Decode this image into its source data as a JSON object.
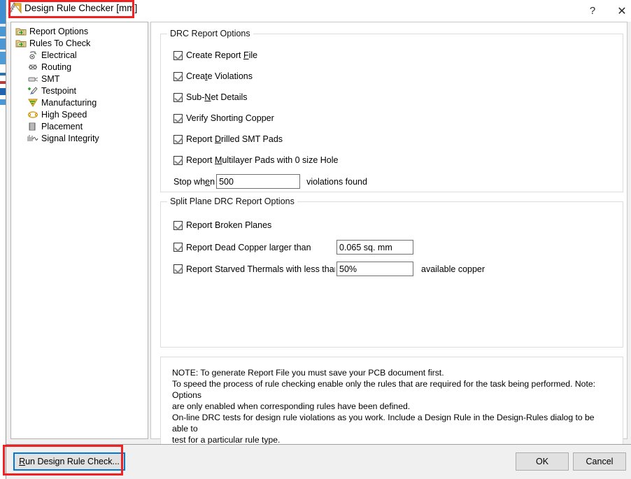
{
  "window": {
    "title": "Design Rule Checker [mm]",
    "icon": "design-rule-checker-icon",
    "help_label": "?",
    "close_label": "✕"
  },
  "sidebar": {
    "items": [
      {
        "label": "Report Options",
        "icon": "folder-arrow-icon",
        "level": 1
      },
      {
        "label": "Rules To Check",
        "icon": "folder-arrow-icon",
        "level": 1
      },
      {
        "label": "Electrical",
        "icon": "electrical-icon",
        "level": 2
      },
      {
        "label": "Routing",
        "icon": "routing-icon",
        "level": 2
      },
      {
        "label": "SMT",
        "icon": "smt-icon",
        "level": 2
      },
      {
        "label": "Testpoint",
        "icon": "testpoint-icon",
        "level": 2
      },
      {
        "label": "Manufacturing",
        "icon": "manufacturing-icon",
        "level": 2
      },
      {
        "label": "High Speed",
        "icon": "high-speed-icon",
        "level": 2
      },
      {
        "label": "Placement",
        "icon": "placement-icon",
        "level": 2
      },
      {
        "label": "Signal Integrity",
        "icon": "signal-integrity-icon",
        "level": 2
      }
    ]
  },
  "drc_group": {
    "title": "DRC Report Options",
    "options": [
      {
        "label_before": "Create Report ",
        "mnemonic": "F",
        "label_after": "ile",
        "checked": true
      },
      {
        "label_before": "Crea",
        "mnemonic": "t",
        "label_after": "e Violations",
        "checked": true
      },
      {
        "label_before": "Sub-",
        "mnemonic": "N",
        "label_after": "et Details",
        "checked": true
      },
      {
        "label_before": "Verify Shorting Copper",
        "mnemonic": "",
        "label_after": "",
        "checked": true
      },
      {
        "label_before": "Report ",
        "mnemonic": "D",
        "label_after": "rilled SMT Pads",
        "checked": true
      },
      {
        "label_before": "Report ",
        "mnemonic": "M",
        "label_after": "ultilayer Pads with 0 size Hole",
        "checked": true
      }
    ],
    "stop_when": {
      "label_before": "Stop wh",
      "mnemonic": "e",
      "label_after": "n",
      "value": "500",
      "suffix": "violations found"
    }
  },
  "split_group": {
    "title": "Split Plane DRC Report Options",
    "broken_planes": {
      "label": "Report Broken Planes",
      "checked": true
    },
    "dead_copper": {
      "label": "Report Dead Copper larger than",
      "checked": true,
      "value": "0.065 sq. mm"
    },
    "starved_thermals": {
      "label": "Report Starved Thermals with less than",
      "checked": true,
      "value": "50%",
      "suffix": "available copper"
    }
  },
  "note": {
    "line1": "NOTE: To generate Report File you must save your PCB document first.",
    "line2": "To speed the process of rule checking enable only the rules that are required for the task being performed.  Note: Options",
    "line3": "are only enabled when corresponding rules have been defined.",
    "line4": "On-line DRC tests for design rule violations as you work. Include a Design Rule in the Design-Rules dialog to be able to",
    "line5": "test for a particular rule  type."
  },
  "footer": {
    "run_label_before": "",
    "run_mnemonic": "R",
    "run_label_after": "un Design Rule Check...",
    "ok_label": "OK",
    "cancel_label": "Cancel"
  },
  "colors": {
    "annotation": "#ee2222",
    "focus": "#0078d7",
    "dialog_bg": "#f0f0f0",
    "panel_bg": "#ffffff",
    "background_strip": "#3f8fd0"
  }
}
